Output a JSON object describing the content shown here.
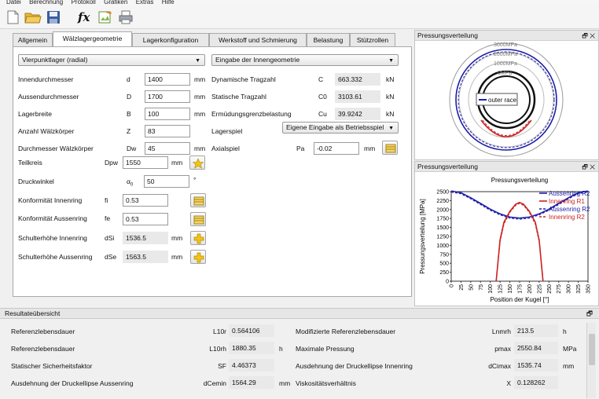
{
  "menu": [
    "Datei",
    "Berechnung",
    "Protokoll",
    "Grafiken",
    "Extras",
    "Hilfe"
  ],
  "toolbar": {
    "icons": [
      "new-file-icon",
      "open-folder-icon",
      "save-icon",
      "formula-icon",
      "edit-icon",
      "print-icon"
    ],
    "formula_glyph": "fx"
  },
  "tabs": [
    "Allgemein",
    "Wälzlagergeometrie",
    "Lagerkonfiguration",
    "Werkstoff und Schmierung",
    "Belastung",
    "Stützrollen"
  ],
  "active_tab": "Wälzlagergeometrie",
  "geometry": {
    "type_select": "Vierpunktlager (radial)",
    "input_mode_select": "Eingabe der Innengeometrie",
    "fields": [
      {
        "label": "Innendurchmesser",
        "symbol": "d",
        "value": "1400",
        "unit": "mm"
      },
      {
        "label": "Aussendurchmesser",
        "symbol": "D",
        "value": "1700",
        "unit": "mm"
      },
      {
        "label": "Lagerbreite",
        "symbol": "B",
        "value": "100",
        "unit": "mm"
      },
      {
        "label": "Anzahl Wälzkörper",
        "symbol": "Z",
        "value": "83",
        "unit": ""
      },
      {
        "label": "Durchmesser Wälzkörper",
        "symbol": "Dw",
        "value": "45",
        "unit": "mm"
      }
    ],
    "teilkreis": {
      "label": "Teilkreis",
      "symbol": "Dpw",
      "value": "1550",
      "unit": "mm"
    },
    "druckwinkel": {
      "label": "Druckwinkel",
      "symbol": "α",
      "symbol_sub": "0",
      "value": "50",
      "unit": "°"
    },
    "konf_innen": {
      "label": "Konformität Innenring",
      "symbol": "fi",
      "value": "0.53"
    },
    "konf_aussen": {
      "label": "Konformität Aussenring",
      "symbol": "fe",
      "value": "0.53"
    },
    "schulter_innen": {
      "label": "Schulterhöhe Innenring",
      "symbol": "dSi",
      "value": "1536.5",
      "unit": "mm"
    },
    "schulter_aussen": {
      "label": "Schulterhöhe Aussenring",
      "symbol": "dSe",
      "value": "1563.5",
      "unit": "mm"
    },
    "right_fields": [
      {
        "label": "Dynamische Tragzahl",
        "symbol": "C",
        "value": "663.332",
        "unit": "kN"
      },
      {
        "label": "Statische Tragzahl",
        "symbol": "C0",
        "value": "3103.61",
        "unit": "kN"
      },
      {
        "label": "Ermüdungsgrenzbelastung",
        "symbol": "Cu",
        "value": "39.9242",
        "unit": "kN"
      }
    ],
    "lagerspiel": {
      "label": "Lagerspiel",
      "select": "Eigene Eingabe als Betriebsspiel"
    },
    "axialspiel": {
      "label": "Axialspiel",
      "symbol": "Pa",
      "value": "-0.02",
      "unit": "mm"
    }
  },
  "polar_panel": {
    "title": "Pressungsverteilung",
    "ring_labels": [
      "3000MPa",
      "2000MPa",
      "1000MPa",
      "0MPa"
    ],
    "legend": "outer race",
    "colors": {
      "outer": "#1f1fa8",
      "inner": "#cc2222"
    }
  },
  "chart_panel": {
    "title": "Pressungsverteilung",
    "float_btn": "🗗",
    "close_btn": "✕"
  },
  "chart_data": {
    "type": "line",
    "title": "Pressungsverteilung",
    "xlabel": "Position der Kugel [°]",
    "ylabel": "Pressungsverteilung [MPa]",
    "xlim": [
      0,
      350
    ],
    "ylim": [
      0,
      2500
    ],
    "xticks": [
      0,
      25,
      50,
      75,
      100,
      125,
      150,
      175,
      200,
      225,
      250,
      275,
      300,
      325,
      350
    ],
    "yticks": [
      0,
      250,
      500,
      750,
      1000,
      1250,
      1500,
      1750,
      2000,
      2250,
      2500
    ],
    "legend_position": "top-right",
    "series": [
      {
        "name": "Aussenring R2",
        "color": "#1f1fa8",
        "dashed": false,
        "x": [
          0,
          25,
          50,
          75,
          100,
          125,
          150,
          175,
          200,
          225,
          250,
          275,
          300,
          325,
          350
        ],
        "values": [
          2520,
          2470,
          2330,
          2170,
          2010,
          1880,
          1790,
          1760,
          1790,
          1880,
          2010,
          2170,
          2330,
          2470,
          2520
        ]
      },
      {
        "name": "Innenring R1",
        "color": "#cc2222",
        "dashed": false,
        "x": [
          115,
          125,
          135,
          150,
          165,
          175,
          185,
          200,
          215,
          225,
          235
        ],
        "values": [
          0,
          1150,
          1650,
          1950,
          2150,
          2200,
          2150,
          1950,
          1650,
          1150,
          0
        ]
      },
      {
        "name": "Aussenring R2",
        "color": "#1f1fa8",
        "dashed": true,
        "x": [
          0,
          25,
          50,
          75,
          100,
          125,
          150,
          175,
          200,
          225,
          250,
          275,
          300,
          325,
          350
        ],
        "values": [
          2490,
          2440,
          2300,
          2140,
          1980,
          1850,
          1760,
          1730,
          1760,
          1850,
          1980,
          2140,
          2300,
          2440,
          2490
        ]
      },
      {
        "name": "Innenring R2",
        "color": "#cc2222",
        "dashed": true,
        "x": [
          115,
          125,
          135,
          150,
          165,
          175,
          185,
          200,
          215,
          225,
          235
        ],
        "values": [
          0,
          1100,
          1600,
          1920,
          2120,
          2170,
          2120,
          1920,
          1600,
          1100,
          0
        ]
      }
    ]
  },
  "results": {
    "title": "Resultateübersicht",
    "rows_left": [
      {
        "label": "Referenzlebensdauer",
        "symbol": "L10r",
        "value": "0.564106",
        "unit": ""
      },
      {
        "label": "Referenzlebensdauer",
        "symbol": "L10rh",
        "value": "1880.35",
        "unit": "h"
      },
      {
        "label": "Statischer Sicherheitsfaktor",
        "symbol": "SF",
        "value": "4.46373",
        "unit": ""
      },
      {
        "label": "Ausdehnung der Druckellipse Aussenring",
        "symbol": "dCemin",
        "value": "1564.29",
        "unit": "mm"
      }
    ],
    "rows_right": [
      {
        "label": "Modifizierte Referenzlebensdauer",
        "symbol": "Lnmrh",
        "value": "213.5",
        "unit": "h"
      },
      {
        "label": "Maximale Pressung",
        "symbol": "pmax",
        "value": "2550.84",
        "unit": "MPa"
      },
      {
        "label": "Ausdehnung der Druckellipse Innenring",
        "symbol": "dCimax",
        "value": "1535.74",
        "unit": "mm"
      },
      {
        "label": "Viskositätsverhältnis",
        "symbol": "X",
        "value": "0.128262",
        "unit": ""
      }
    ]
  }
}
